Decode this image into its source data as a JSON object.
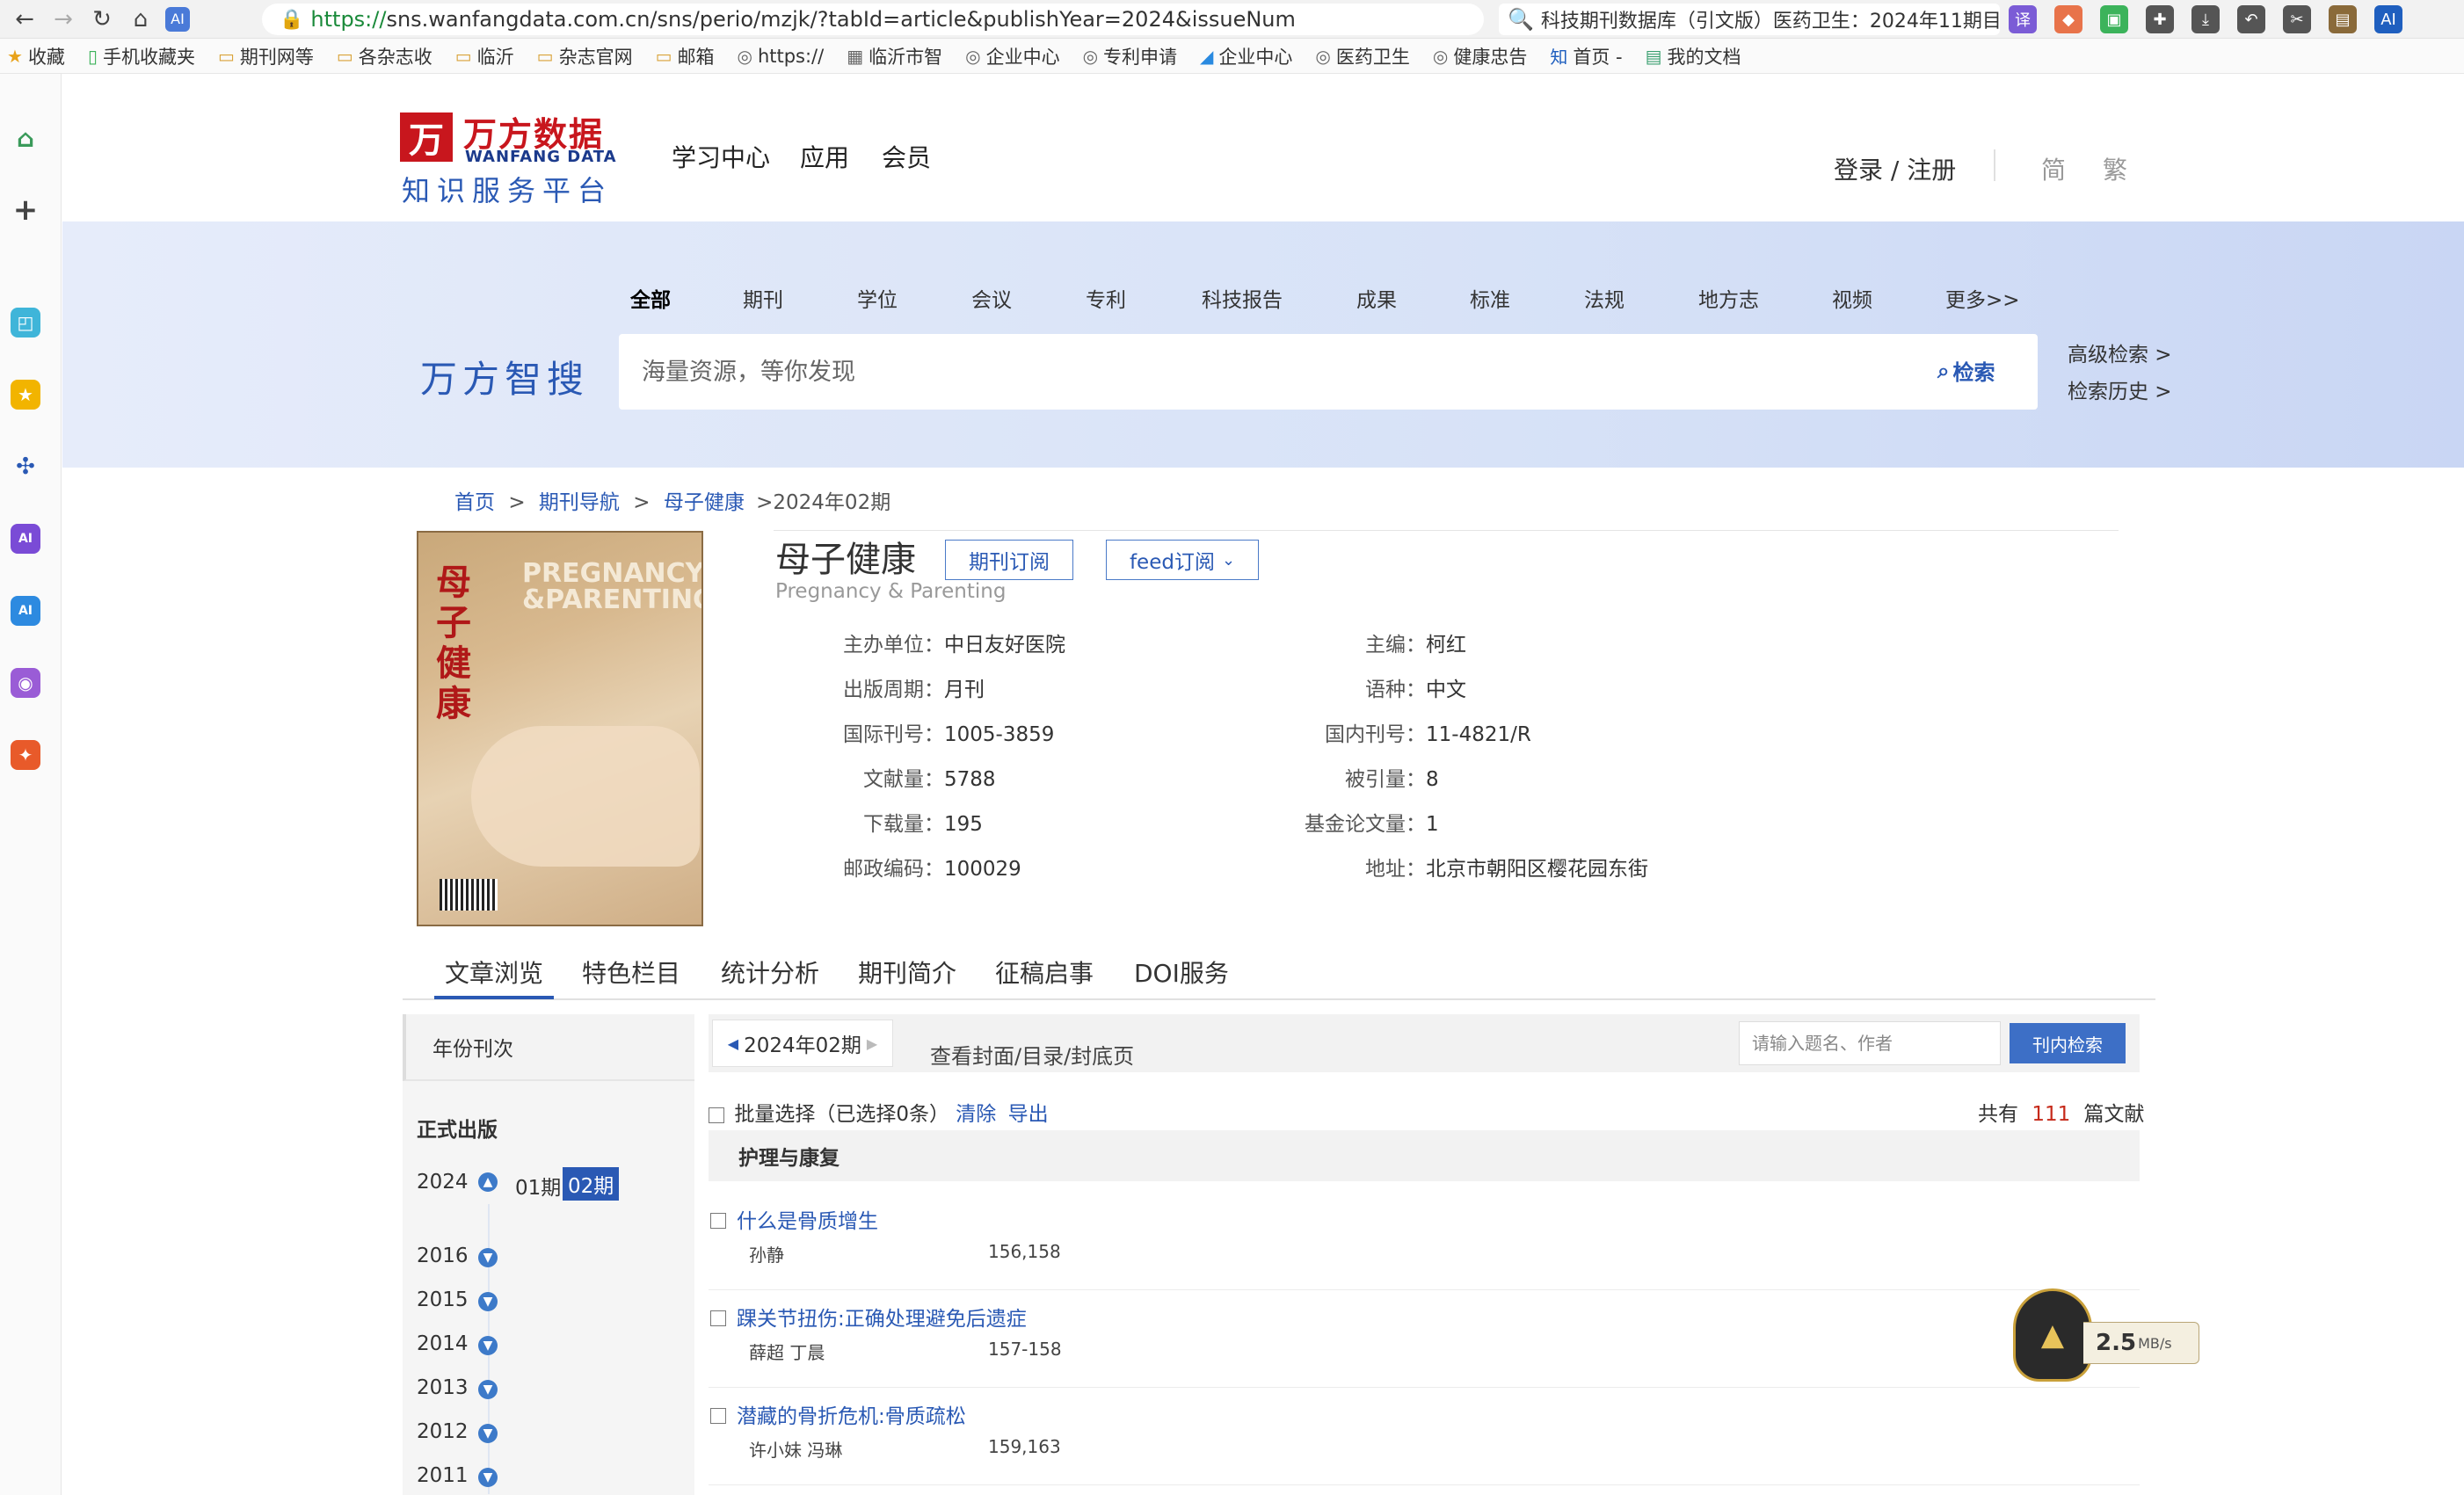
{
  "browser": {
    "url_scheme": "https://",
    "url_rest": "sns.wanfangdata.com.cn/sns/perio/mzjk/?tabId=article&publishYear=2024&issueNum",
    "search_tab_text": "科技期刊数据库（引文版）医药卫生：2024年11期目",
    "ext_colors": [
      "#7b5cd6",
      "#e8734a",
      "#3cb35b",
      "#555555",
      "#555555",
      "#555555",
      "#555555",
      "#8a6a3a",
      "#1f5fbf"
    ]
  },
  "bookmarks": [
    "收藏",
    "手机收藏夹",
    "期刊网等",
    "各杂志收",
    "临沂",
    "杂志官网",
    "邮箱",
    "https://",
    "临沂市智",
    "企业中心",
    "专利申请",
    "企业中心",
    "医药卫生",
    "健康忠告",
    "首页 -",
    "我的文档"
  ],
  "header": {
    "logo_mark": "万",
    "logo_cn": "万方数据",
    "logo_en": "WANFANG DATA",
    "logo_sub": "知识服务平台",
    "nav": [
      "学习中心",
      "应用",
      "会员"
    ],
    "login": "登录 / 注册",
    "lang_simplified": "简",
    "lang_traditional": "繁"
  },
  "search": {
    "brand": "万方智搜",
    "tabs": [
      "全部",
      "期刊",
      "学位",
      "会议",
      "专利",
      "科技报告",
      "成果",
      "标准",
      "法规",
      "地方志",
      "视频",
      "更多>>"
    ],
    "placeholder": "海量资源，等你发现",
    "button": "检索",
    "advanced": "高级检索 >",
    "history": "检索历史 >"
  },
  "breadcrumb": {
    "home": "首页",
    "sep": ">",
    "journals": "期刊导航",
    "journal": "母子健康",
    "current": ">2024年02期"
  },
  "journal": {
    "cover_title": "母子健康",
    "cover_en": "PREGNANCY &PARENTING",
    "title": "母子健康",
    "title_en": "Pregnancy & Parenting",
    "subscribe": "期刊订阅",
    "feed": "feed订阅",
    "left_fields": [
      {
        "k": "主办单位：",
        "v": "中日友好医院"
      },
      {
        "k": "出版周期：",
        "v": "月刊"
      },
      {
        "k": "国际刊号：",
        "v": "1005-3859"
      },
      {
        "k": "文献量：",
        "v": "5788"
      },
      {
        "k": "下载量：",
        "v": "195"
      },
      {
        "k": "邮政编码：",
        "v": "100029"
      }
    ],
    "right_fields": [
      {
        "k": "主编：",
        "v": "柯红"
      },
      {
        "k": "语种：",
        "v": "中文"
      },
      {
        "k": "国内刊号：",
        "v": "11-4821/R"
      },
      {
        "k": "被引量：",
        "v": "8"
      },
      {
        "k": "基金论文量：",
        "v": "1"
      },
      {
        "k": "地址：",
        "v": "北京市朝阳区樱花园东街"
      }
    ]
  },
  "tabs": [
    "文章浏览",
    "特色栏目",
    "统计分析",
    "期刊简介",
    "征稿启事",
    "DOI服务"
  ],
  "filter": {
    "header": "年份刊次",
    "official": "正式出版",
    "current_year": "2024",
    "issue_other": "01期",
    "issue_selected": "02期",
    "years": [
      "2016",
      "2015",
      "2014",
      "2013",
      "2012",
      "2011"
    ]
  },
  "list": {
    "issue": "2024年02期",
    "view_cover": "查看封面/目录/封底页",
    "kw_placeholder": "请输入题名、作者",
    "kw_button": "刊内检索",
    "batch_label": "批量选择（已选择0条）",
    "clear": "清除",
    "export": "导出",
    "total_prefix": "共有",
    "total_count": "111",
    "total_suffix": "篇文献",
    "category": "护理与康复",
    "articles": [
      {
        "title": "什么是骨质增生",
        "authors": "孙静",
        "pages": "156,158"
      },
      {
        "title": "踝关节扭伤:正确处理避免后遗症",
        "authors": "薛超 丁晨",
        "pages": "157-158"
      },
      {
        "title": "潜藏的骨折危机:骨质疏松",
        "authors": "许小妹 冯琳",
        "pages": "159,163"
      }
    ]
  },
  "speed": {
    "value": "2.5",
    "unit": "MB/s"
  }
}
